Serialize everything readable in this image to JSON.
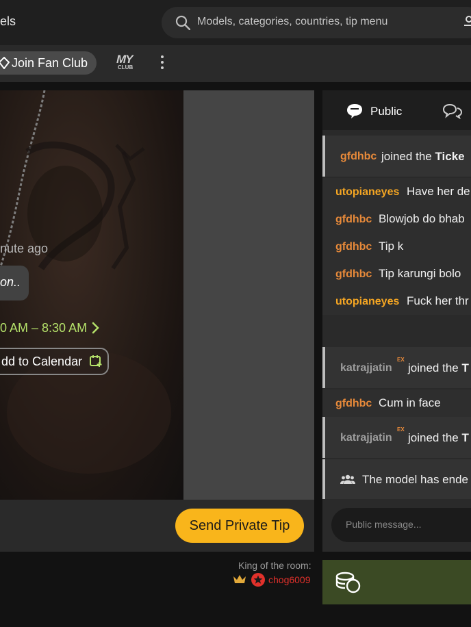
{
  "header": {
    "nav_fragment": "els",
    "search_placeholder": "Models, categories, countries, tip menu"
  },
  "subbar": {
    "fan_club_label": "Join Fan Club",
    "myclub_top": "MY",
    "myclub_bottom": "CLUB"
  },
  "event": {
    "time_ago": "nute ago",
    "description": "on..",
    "time_range": "0 AM – 8:30 AM",
    "add_to_calendar": "dd to Calendar"
  },
  "controls": {
    "private_tip_label": "Send Private Tip"
  },
  "king": {
    "label": "King of the room:",
    "name": "chog6009"
  },
  "chat": {
    "tab_public": "Public",
    "system_1": {
      "user": "gfdhbc",
      "text_pre": "joined the ",
      "text_bold": "Ticke"
    },
    "messages": [
      {
        "user": "utopianeyes",
        "text": "Have her de",
        "color": "#f5a623"
      },
      {
        "user": "gfdhbc",
        "text": "Blowjob do bhab",
        "color": "#e88a3a"
      },
      {
        "user": "gfdhbc",
        "text": "Tip k",
        "color": "#e88a3a"
      },
      {
        "user": "gfdhbc",
        "text": "Tip karungi bolo",
        "color": "#e88a3a"
      },
      {
        "user": "utopianeyes",
        "text": "Fuck her thr",
        "color": "#f5a623"
      }
    ],
    "system_2": {
      "user": "katrajjatin",
      "badge": "EX",
      "text_pre": "joined the ",
      "text_bold": "T"
    },
    "message_6": {
      "user": "gfdhbc",
      "text": "Cum in face",
      "color": "#e88a3a"
    },
    "system_3": {
      "user": "katrajjatin",
      "badge": "EX",
      "text_pre": "joined the ",
      "text_bold": "T"
    },
    "system_4": {
      "text": "The model has ende"
    },
    "input_placeholder": "Public message..."
  },
  "colors": {
    "accent_yellow": "#f9b51b",
    "schedule_green": "#b5e26a",
    "king_red": "#e2312b",
    "tokens_bar": "#3b4a24"
  }
}
